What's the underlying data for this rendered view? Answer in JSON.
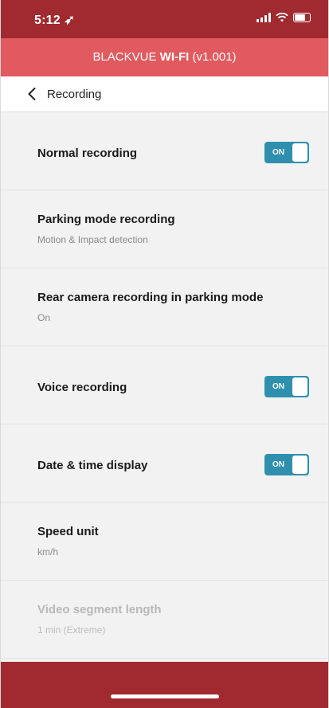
{
  "status_bar": {
    "time": "5:12"
  },
  "app_bar": {
    "brand": "BLACKVUE",
    "wifi": "WI-FI",
    "version": "(v1.001)"
  },
  "nav": {
    "title": "Recording"
  },
  "toggle_color": "#2f8fae",
  "items": [
    {
      "title": "Normal recording",
      "toggle": "ON"
    },
    {
      "title": "Parking mode recording",
      "subtitle": "Motion & Impact detection"
    },
    {
      "title": "Rear camera recording in parking mode",
      "subtitle": "On"
    },
    {
      "title": "Voice recording",
      "toggle": "ON"
    },
    {
      "title": "Date & time display",
      "toggle": "ON"
    },
    {
      "title": "Speed unit",
      "subtitle": "km/h"
    },
    {
      "title": "Video segment length",
      "subtitle": "1 min (Extreme)",
      "disabled": true
    }
  ]
}
